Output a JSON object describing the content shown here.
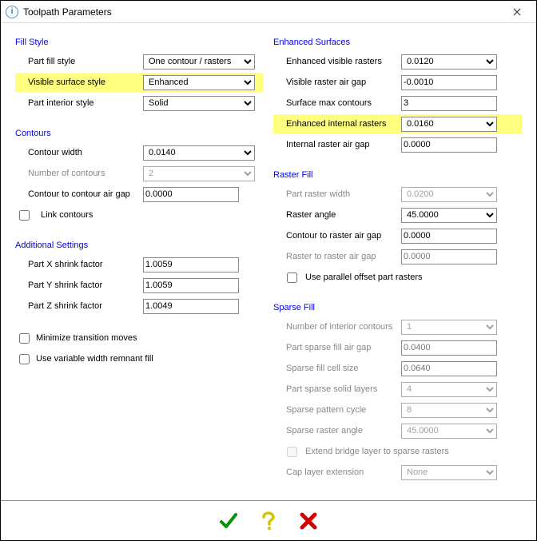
{
  "window": {
    "title": "Toolpath Parameters"
  },
  "left": {
    "fillStyle": {
      "title": "Fill Style",
      "partFillStyle": {
        "label": "Part fill style",
        "value": "One contour / rasters"
      },
      "visibleSurfaceStyle": {
        "label": "Visible surface style",
        "value": "Enhanced"
      },
      "partInteriorStyle": {
        "label": "Part interior style",
        "value": "Solid"
      }
    },
    "contours": {
      "title": "Contours",
      "contourWidth": {
        "label": "Contour width",
        "value": "0.0140"
      },
      "numberOfContours": {
        "label": "Number of contours",
        "value": "2"
      },
      "contourToContourAirGap": {
        "label": "Contour to contour air gap",
        "value": "0.0000"
      },
      "linkContours": {
        "label": "Link contours",
        "checked": false
      }
    },
    "additional": {
      "title": "Additional Settings",
      "partXShrink": {
        "label": "Part X shrink factor",
        "value": "1.0059"
      },
      "partYShrink": {
        "label": "Part Y shrink factor",
        "value": "1.0059"
      },
      "partZShrink": {
        "label": "Part Z shrink factor",
        "value": "1.0049"
      }
    },
    "minimizeTransition": {
      "label": "Minimize transition moves",
      "checked": false
    },
    "useVariableWidth": {
      "label": "Use variable width remnant fill",
      "checked": false
    }
  },
  "right": {
    "enhanced": {
      "title": "Enhanced Surfaces",
      "visibleRasters": {
        "label": "Enhanced visible rasters",
        "value": "0.0120"
      },
      "visibleRasterAirGap": {
        "label": "Visible raster air gap",
        "value": "-0.0010"
      },
      "surfaceMaxContours": {
        "label": "Surface max contours",
        "value": "3"
      },
      "internalRasters": {
        "label": "Enhanced internal rasters",
        "value": "0.0160"
      },
      "internalRasterAirGap": {
        "label": "Internal raster air gap",
        "value": "0.0000"
      }
    },
    "rasterFill": {
      "title": "Raster Fill",
      "partRasterWidth": {
        "label": "Part raster width",
        "value": "0.0200"
      },
      "rasterAngle": {
        "label": "Raster angle",
        "value": "45.0000"
      },
      "contourToRasterAirGap": {
        "label": "Contour to raster air gap",
        "value": "0.0000"
      },
      "rasterToRasterAirGap": {
        "label": "Raster to raster air gap",
        "value": "0.0000"
      },
      "useParallelOffset": {
        "label": "Use parallel offset part rasters",
        "checked": false
      }
    },
    "sparseFill": {
      "title": "Sparse Fill",
      "numInteriorContours": {
        "label": "Number of interior contours",
        "value": "1"
      },
      "partSparseFillAirGap": {
        "label": "Part sparse fill air gap",
        "value": "0.0400"
      },
      "sparseFillCellSize": {
        "label": "Sparse fill cell size",
        "value": "0.0640"
      },
      "partSparseSolidLayers": {
        "label": "Part sparse solid layers",
        "value": "4"
      },
      "sparsePatternCycle": {
        "label": "Sparse pattern cycle",
        "value": "8"
      },
      "sparseRasterAngle": {
        "label": "Sparse raster angle",
        "value": "45.0000"
      },
      "extendBridgeLayer": {
        "label": "Extend bridge layer to sparse rasters",
        "checked": false
      },
      "capLayerExtension": {
        "label": "Cap layer extension",
        "value": "None"
      }
    }
  }
}
